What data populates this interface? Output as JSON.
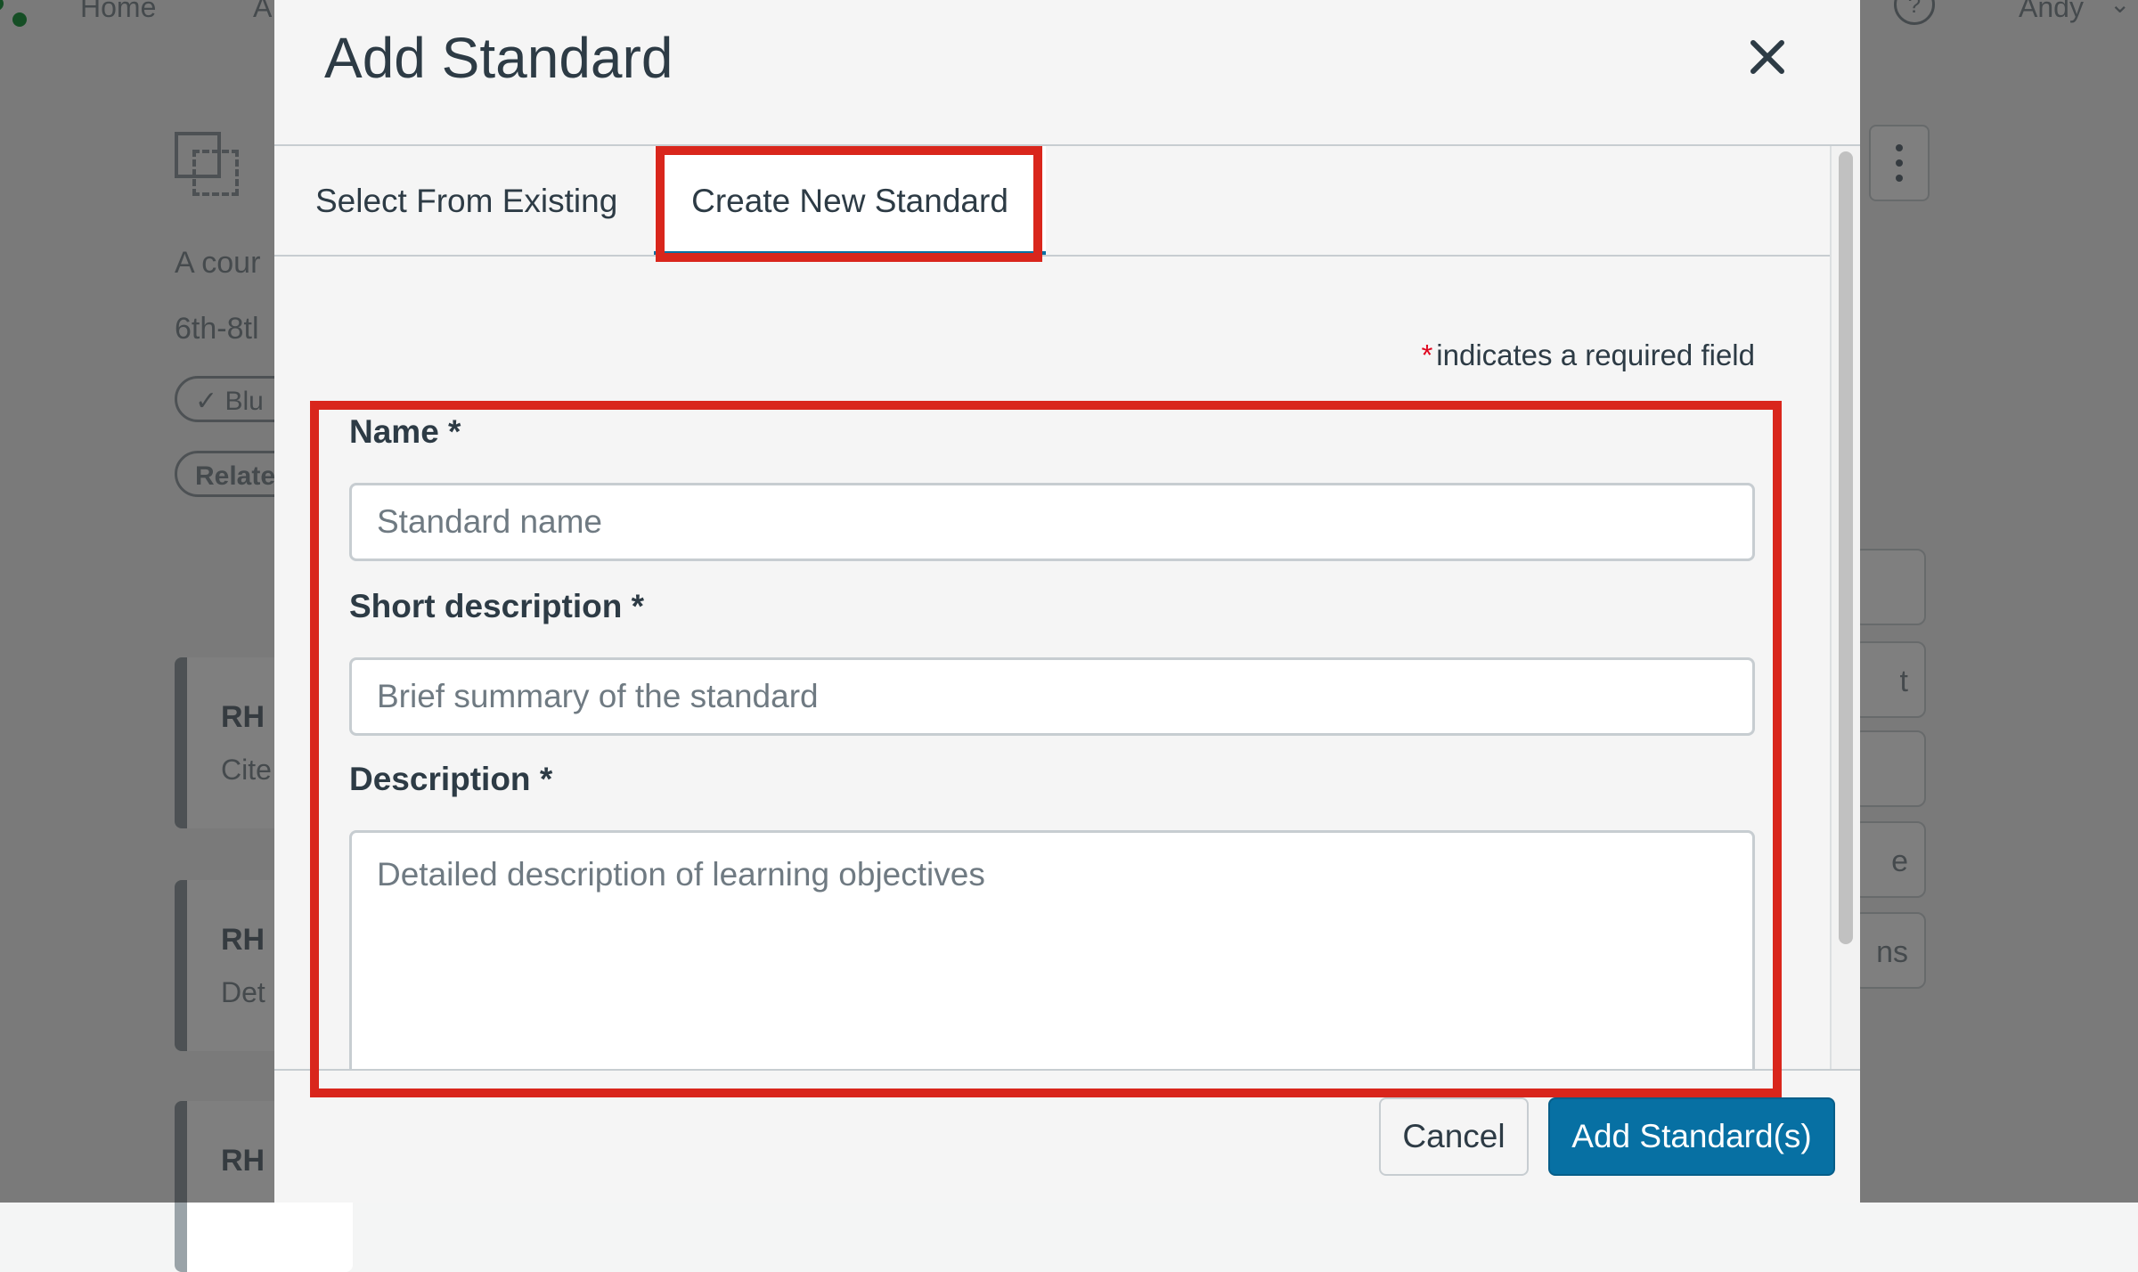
{
  "background": {
    "nav_items": [
      "Home",
      "A"
    ],
    "user_name": "Andy",
    "help_glyph": "?",
    "course_lines": [
      "A cour",
      "6th-8tl"
    ],
    "pills": [
      "Blu",
      "Relate"
    ],
    "cards": [
      {
        "title": "RH",
        "subtitle": "Cite"
      },
      {
        "title": "RH",
        "subtitle": "Det"
      },
      {
        "title": "RH",
        "subtitle": ""
      }
    ],
    "side_buttons": [
      "",
      "t",
      "",
      "e",
      "ns"
    ]
  },
  "modal": {
    "title": "Add Standard",
    "close_icon": "close-icon",
    "tabs": [
      {
        "label": "Select From Existing",
        "selected": false
      },
      {
        "label": "Create New Standard",
        "selected": true
      }
    ],
    "required_note": {
      "asterisk": "*",
      "text": "indicates a required field"
    },
    "fields": {
      "name": {
        "label": "Name *",
        "placeholder": "Standard name",
        "value": ""
      },
      "short_description": {
        "label": "Short description *",
        "placeholder": "Brief summary of the standard",
        "value": ""
      },
      "description": {
        "label": "Description *",
        "placeholder": "Detailed description of learning objectives",
        "value": ""
      }
    },
    "footer": {
      "cancel_label": "Cancel",
      "add_label": "Add Standard(s)"
    }
  },
  "colors": {
    "primary": "#0770a3",
    "highlight": "#d9261c",
    "required": "#e0061f",
    "text": "#2d3b45"
  }
}
